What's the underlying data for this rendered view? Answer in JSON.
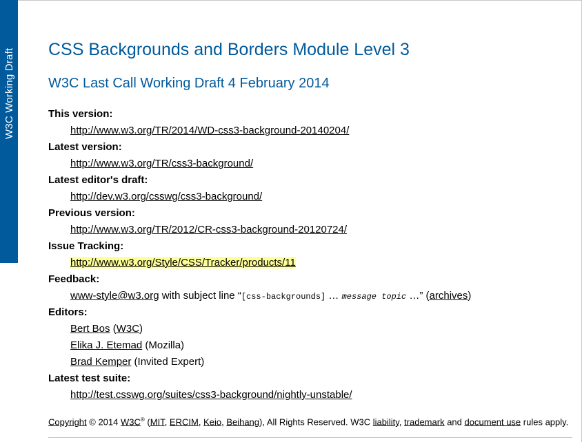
{
  "logo": {
    "text": "W3C Working Draft"
  },
  "title": "CSS Backgrounds and Borders Module Level 3",
  "subtitle": "W3C Last Call Working Draft 4 February 2014",
  "meta": {
    "this_version": {
      "label": "This version:",
      "link": "http://www.w3.org/TR/2014/WD-css3-background-20140204/"
    },
    "latest_version": {
      "label": "Latest version:",
      "link": "http://www.w3.org/TR/css3-background/"
    },
    "editors_draft": {
      "label": "Latest editor's draft:",
      "link": "http://dev.w3.org/csswg/css3-background/"
    },
    "previous_version": {
      "label": "Previous version:",
      "link": "http://www.w3.org/TR/2012/CR-css3-background-20120724/"
    },
    "issue_tracking": {
      "label": "Issue Tracking:",
      "link": "http://www.w3.org/Style/CSS/Tracker/products/11"
    },
    "feedback": {
      "label": "Feedback:",
      "email": "www-style@w3.org",
      "text_subject": " with subject line “",
      "code": "[css-backgrounds]",
      "ellipsis1": " … ",
      "var": "message topic",
      "ellipsis2": " …” (",
      "archives": "archives",
      "close": ")"
    },
    "editors": {
      "label": "Editors:",
      "list": [
        {
          "name": "Bert Bos",
          "sep": " (",
          "org": "W3C",
          "end": ")"
        },
        {
          "name": "Elika J. Etemad",
          "affiliation": " (Mozilla)"
        },
        {
          "name": "Brad Kemper",
          "affiliation": " (Invited Expert)"
        }
      ]
    },
    "test_suite": {
      "label": "Latest test suite:",
      "link": "http://test.csswg.org/suites/css3-background/nightly-unstable/"
    }
  },
  "copyright": {
    "link": "Copyright",
    "year": " © 2014 ",
    "w3c": "W3C",
    "reg": "®",
    "open": " (",
    "mit": "MIT",
    "ercim": "ERCIM",
    "keio": "Keio",
    "beihang": "Beihang",
    "rights": "), All Rights Reserved. W3C ",
    "liability": "liability",
    "trademark": "trademark",
    "and": " and ",
    "document_use": "document use",
    "end": " rules apply."
  }
}
